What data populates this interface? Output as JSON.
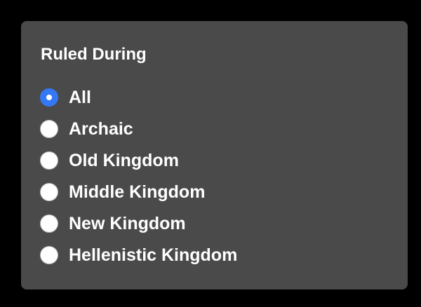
{
  "group": {
    "title": "Ruled During",
    "selected_index": 0,
    "options": [
      {
        "label": "All",
        "selected": true
      },
      {
        "label": "Archaic",
        "selected": false
      },
      {
        "label": "Old Kingdom",
        "selected": false
      },
      {
        "label": "Middle Kingdom",
        "selected": false
      },
      {
        "label": "New Kingdom",
        "selected": false
      },
      {
        "label": "Hellenistic Kingdom",
        "selected": false
      }
    ]
  },
  "colors": {
    "background": "#000000",
    "panel": "#4a4a4a",
    "text": "#ffffff",
    "accent": "#3478f6",
    "radio_border": "#b9b9b9"
  }
}
